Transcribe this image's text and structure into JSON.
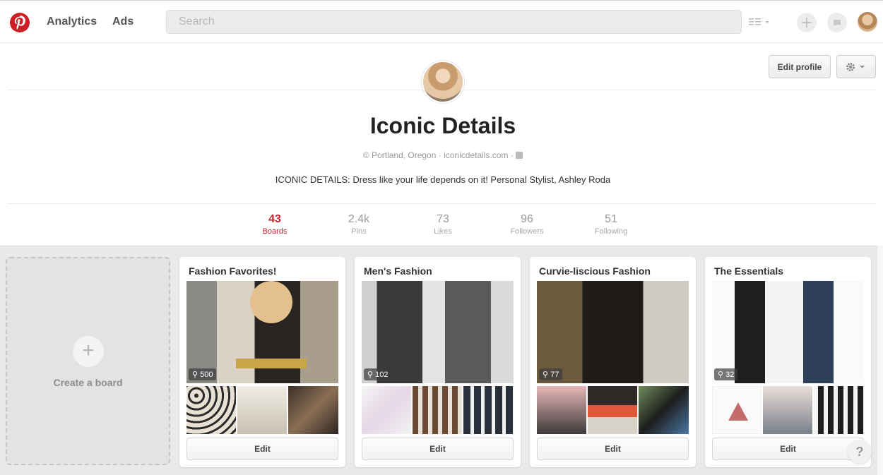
{
  "nav": {
    "analytics": "Analytics",
    "ads": "Ads",
    "search_placeholder": "Search"
  },
  "profile": {
    "edit_profile": "Edit profile",
    "name": "Iconic Details",
    "location": "Portland, Oregon",
    "website": "iconicdetails.com",
    "about": "ICONIC DETAILS: Dress like your life depends on it! Personal Stylist, Ashley Roda"
  },
  "stats": [
    {
      "value": "43",
      "label": "Boards"
    },
    {
      "value": "2.4k",
      "label": "Pins"
    },
    {
      "value": "73",
      "label": "Likes"
    },
    {
      "value": "96",
      "label": "Followers"
    },
    {
      "value": "51",
      "label": "Following"
    }
  ],
  "create_board": {
    "label": "Create a board",
    "plus": "+"
  },
  "boards": [
    {
      "title": "Fashion Favorites!",
      "pins": "500",
      "edit": "Edit"
    },
    {
      "title": "Men's Fashion",
      "pins": "102",
      "edit": "Edit"
    },
    {
      "title": "Curvie-liscious Fashion",
      "pins": "77",
      "edit": "Edit"
    },
    {
      "title": "The Essentials",
      "pins": "32",
      "edit": "Edit"
    }
  ],
  "help": "?",
  "colors": {
    "brand": "#cb2027",
    "active_stat": "#c8232c"
  },
  "icons": [
    "pinterest-logo-icon",
    "list-view-icon",
    "add-icon",
    "messages-icon",
    "settings-gear-icon",
    "location-icon",
    "facebook-icon",
    "pin-icon"
  ]
}
